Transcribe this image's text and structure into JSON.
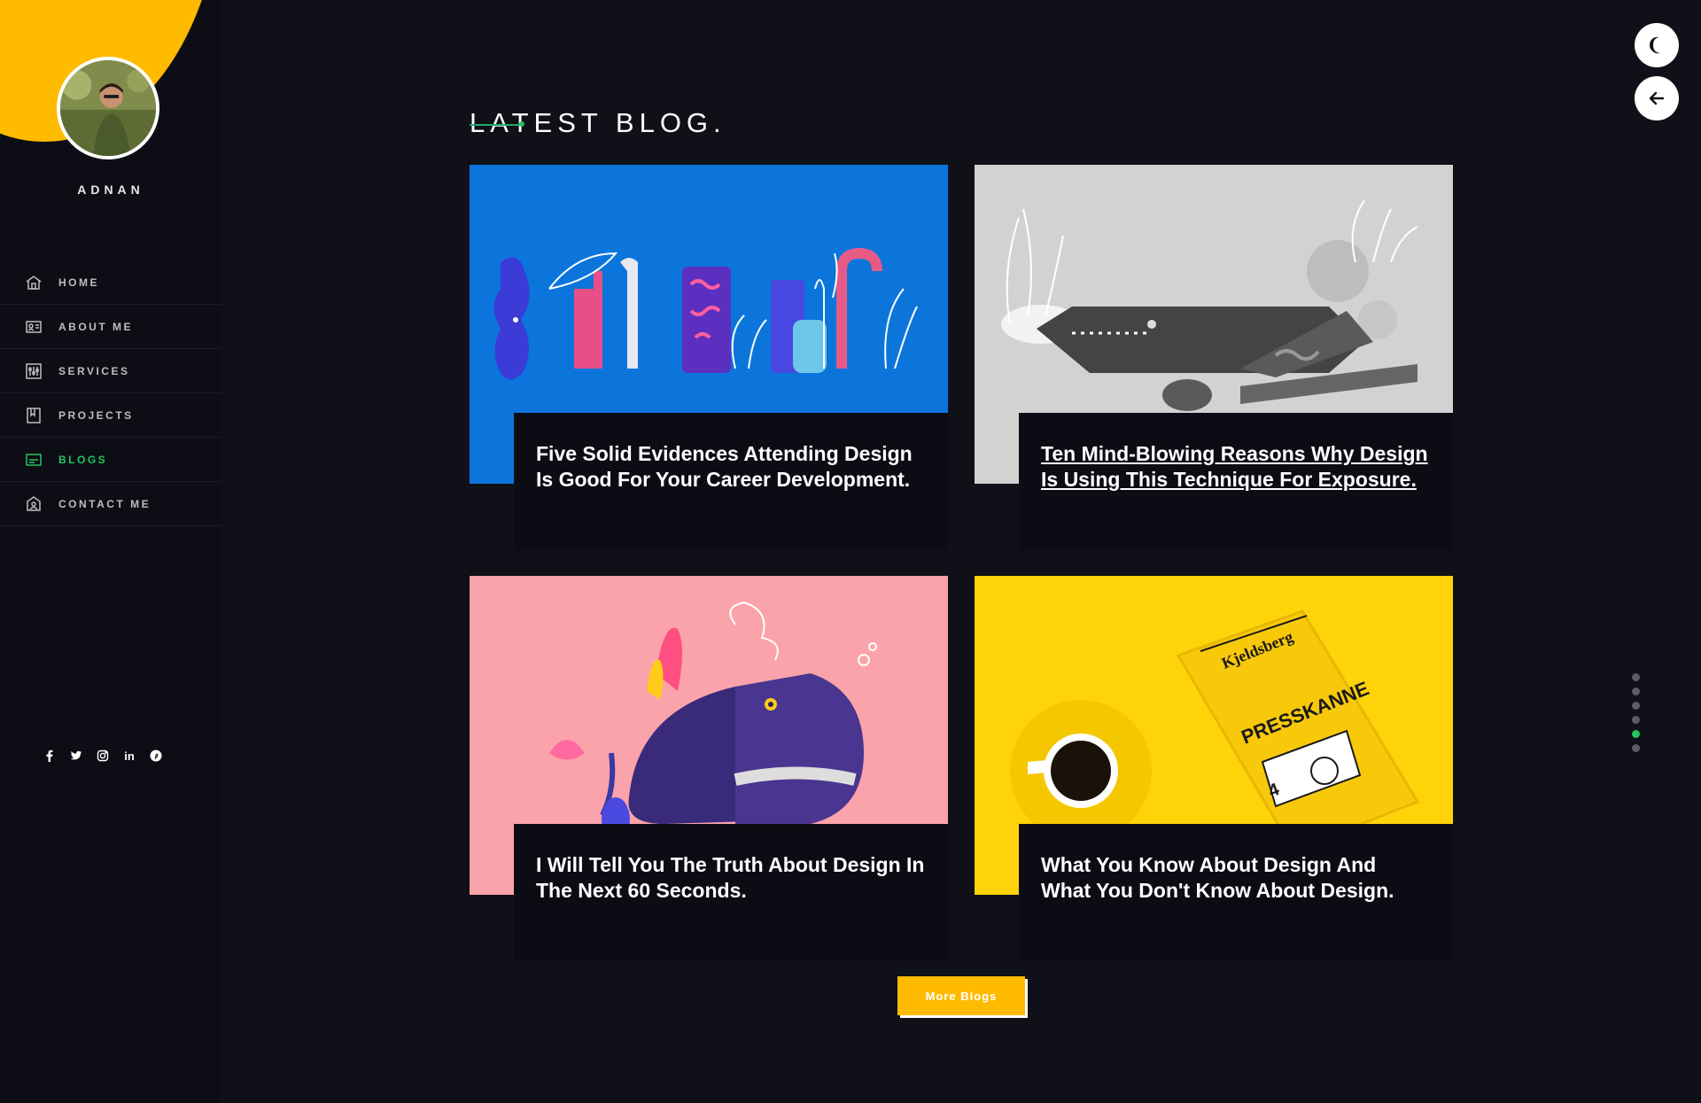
{
  "profile": {
    "name": "ADNAN"
  },
  "nav": {
    "items": [
      {
        "label": "HOME",
        "icon": "home-icon"
      },
      {
        "label": "ABOUT ME",
        "icon": "id-card-icon"
      },
      {
        "label": "SERVICES",
        "icon": "sliders-icon"
      },
      {
        "label": "PROJECTS",
        "icon": "bookmark-icon"
      },
      {
        "label": "BLOGS",
        "icon": "blog-icon",
        "active": true
      },
      {
        "label": "CONTACT ME",
        "icon": "contact-icon"
      }
    ]
  },
  "social": {
    "linkedin": "in"
  },
  "main": {
    "title": "LATEST BLOG.",
    "posts": [
      {
        "title": "Five Solid Evidences Attending Design Is Good For Your Career Development.",
        "image_bg": "#0c75dc"
      },
      {
        "title": "Ten Mind-Blowing Reasons Why Design Is Using This Technique For Exposure.",
        "image_bg": "#d2d2d2",
        "hovered": true
      },
      {
        "title": "I Will Tell You The Truth About Design In The Next 60 Seconds.",
        "image_bg": "#fba3aa"
      },
      {
        "title": "What You Know About Design And What You Don't Know About Design.",
        "image_bg": "#ffd30a"
      }
    ],
    "more_button": "More Blogs"
  },
  "controls": {
    "theme_toggle": "moon-icon",
    "back": "arrow-left-icon"
  },
  "pager": {
    "count": 6,
    "active_index": 4
  },
  "colors": {
    "accent": "#ffbb00",
    "active": "#22c55e",
    "background": "#0f1018"
  }
}
